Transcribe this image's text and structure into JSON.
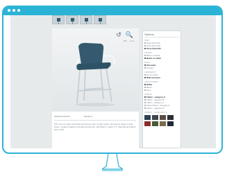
{
  "colors": {
    "frame": "#2bb3d6",
    "screen_bg": "#e7eaeb",
    "seat": "#355a6f",
    "chrome": "#c3ccd1"
  },
  "titlebar": {
    "dots": [
      "dot",
      "dot",
      "dot"
    ]
  },
  "thumbnails": [
    "chair-view-1",
    "chair-view-2",
    "chair-view-3",
    "chair-view-4"
  ],
  "viewer": {
    "tools": [
      {
        "icon": "rotate-icon",
        "glyph": "↺",
        "label": "360"
      },
      {
        "icon": "zoom-icon",
        "glyph": "🔍",
        "label": "zoom"
      }
    ]
  },
  "product": {
    "meta_left": "SPECIFICATION",
    "meta_right": "DETAILS",
    "description": "XXX. Item et vitae commodo fermentum velit, in dolor quam, fermentum quam in ante ipsum, magni et adipis commodo fermentum, permittere in dolor. 5 fl - Expedit permittere dolor. WW."
  },
  "options": {
    "header": "Options",
    "groups": [
      {
        "title": "SEAT",
        "items": [
          {
            "label": "Stool Seat 010",
            "selected": false
          },
          {
            "label": "Stool Seat 020",
            "selected": false
          },
          {
            "label": "Stool Seat 030",
            "selected": true
          }
        ]
      },
      {
        "title": "FRAME",
        "items": [
          {
            "label": "Black on black",
            "selected": false
          },
          {
            "label": "Black on white",
            "selected": true
          }
        ]
      },
      {
        "title": "BASE",
        "items": [
          {
            "label": "Chromed",
            "selected": true
          },
          {
            "label": "Powder",
            "selected": false
          }
        ]
      },
      {
        "title": "ARMRESTS",
        "items": [
          {
            "label": "No armrests",
            "selected": false
          },
          {
            "label": "With armrests",
            "selected": true
          }
        ]
      },
      {
        "title": "UPHOLSTERY",
        "items": [
          {
            "label": "White",
            "selected": true
          },
          {
            "label": "Black",
            "selected": false
          },
          {
            "label": "Grey",
            "selected": false
          }
        ]
      },
      {
        "title": "FABRIC",
        "items": [
          {
            "label": "Fabric - category A",
            "selected": true
          },
          {
            "label": "Fabric - category B",
            "selected": false
          },
          {
            "label": "Fabric - category C",
            "selected": false
          },
          {
            "label": "Fabric Mesh - category D",
            "selected": false
          },
          {
            "label": "Fabric - category E",
            "selected": false
          }
        ]
      }
    ],
    "swatch_title": "FABRIC - CATEGORY A",
    "swatches": [
      "#2e4152",
      "#3d4650",
      "#5a4c45",
      "#2b2f33",
      "#8b2e2a",
      "#4a5a35",
      "#7b6a4f",
      "#1f2a36"
    ]
  }
}
